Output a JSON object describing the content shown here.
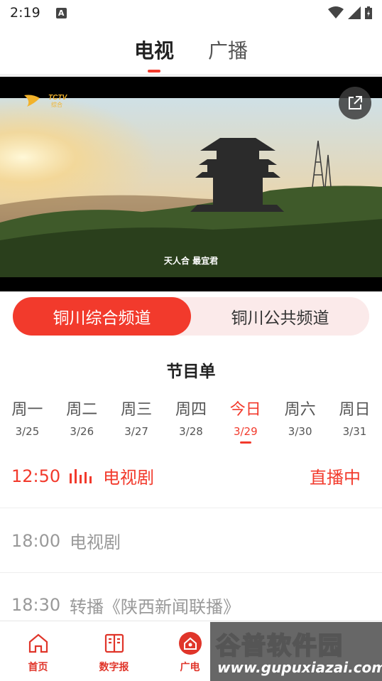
{
  "status_bar": {
    "time": "2:19",
    "notif_letter": "A"
  },
  "top_tabs": [
    {
      "label": "电视",
      "active": true
    },
    {
      "label": "广播",
      "active": false
    }
  ],
  "video": {
    "logo_text": "TCTV",
    "logo_sub": "综合",
    "caption": "天人合 最宜君"
  },
  "channels": [
    {
      "label": "铜川综合频道",
      "active": true
    },
    {
      "label": "铜川公共频道",
      "active": false
    }
  ],
  "schedule_title": "节目单",
  "days": [
    {
      "name": "周一",
      "date": "3/25"
    },
    {
      "name": "周二",
      "date": "3/26"
    },
    {
      "name": "周三",
      "date": "3/27"
    },
    {
      "name": "周四",
      "date": "3/28"
    },
    {
      "name": "今日",
      "date": "3/29",
      "active": true
    },
    {
      "name": "周六",
      "date": "3/30"
    },
    {
      "name": "周日",
      "date": "3/31"
    }
  ],
  "programs": [
    {
      "time": "12:50",
      "name": "电视剧",
      "live": true,
      "status": "直播中"
    },
    {
      "time": "18:00",
      "name": "电视剧"
    },
    {
      "time": "18:30",
      "name": "转播《陕西新闻联播》"
    }
  ],
  "bottom_nav": [
    {
      "label": "首页",
      "icon": "home-icon"
    },
    {
      "label": "数字报",
      "icon": "book-icon"
    },
    {
      "label": "广电",
      "icon": "tv-icon"
    }
  ],
  "watermark": {
    "title": "谷普软件园",
    "url": "www.gupuxiazai.com"
  },
  "colors": {
    "accent": "#f23a2c",
    "pill_bg": "#fbeaea"
  }
}
